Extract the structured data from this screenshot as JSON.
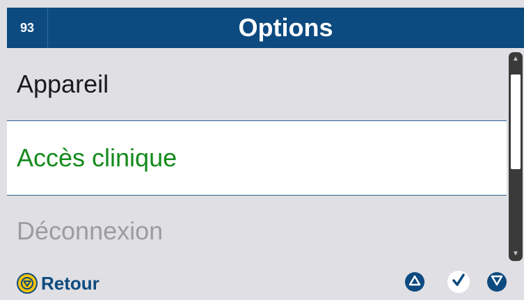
{
  "header": {
    "page_number": "93",
    "title": "Options"
  },
  "menu": {
    "items": [
      {
        "label": "Appareil",
        "state": "normal"
      },
      {
        "label": "Accès clinique",
        "state": "selected"
      },
      {
        "label": "Déconnexion",
        "state": "disabled"
      }
    ]
  },
  "scrollbar": {
    "up_icon": "triangle-up",
    "down_icon": "triangle-down",
    "visible_fraction": 0.45
  },
  "footer": {
    "back_label": "Retour",
    "back_icon": "circle-triangle-down-icon",
    "up_icon": "triangle-up-icon",
    "ok_icon": "checkmark-icon",
    "down_icon": "triangle-down-icon"
  },
  "colors": {
    "header_bg": "#0c4a7f",
    "selected_text": "#138a1b",
    "disabled_text": "#9c9c9e",
    "accent_yellow": "#f4c20d"
  }
}
